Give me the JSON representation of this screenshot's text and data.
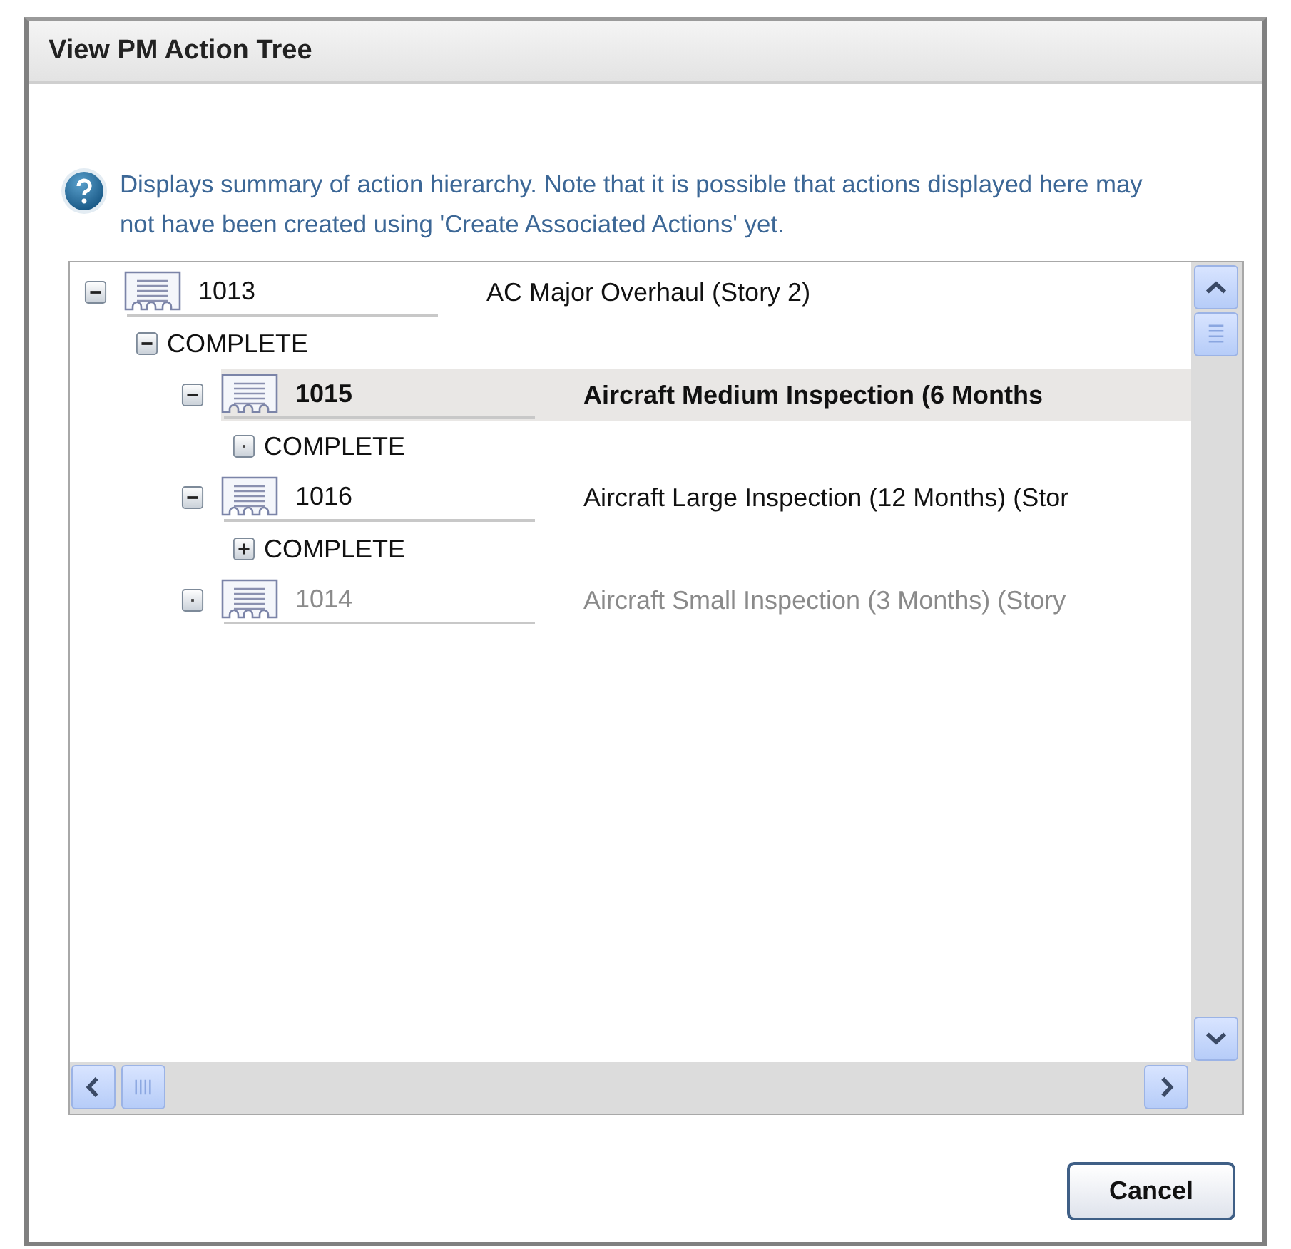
{
  "window": {
    "title": "View PM Action Tree"
  },
  "info": {
    "text": "Displays summary of action hierarchy. Note that it is possible that actions displayed here may not have been created using 'Create Associated Actions' yet."
  },
  "tree": [
    {
      "kind": "action",
      "id": "1013",
      "description": "AC Major Overhaul (Story 2)",
      "expandable": true,
      "expanded": true,
      "selected": false,
      "disabled": false,
      "children": [
        {
          "kind": "status",
          "label": "COMPLETE",
          "expandable": true,
          "expanded": true,
          "children": [
            {
              "kind": "action",
              "id": "1015",
              "description": "Aircraft Medium Inspection (6 Months",
              "expandable": true,
              "expanded": true,
              "selected": true,
              "disabled": false,
              "children": [
                {
                  "kind": "status",
                  "label": "COMPLETE",
                  "expandable": false
                }
              ]
            },
            {
              "kind": "action",
              "id": "1016",
              "description": "Aircraft Large Inspection (12 Months) (Stor",
              "expandable": true,
              "expanded": true,
              "selected": false,
              "disabled": false,
              "children": [
                {
                  "kind": "status",
                  "label": "COMPLETE",
                  "expandable": true,
                  "expanded": false
                }
              ]
            },
            {
              "kind": "action",
              "id": "1014",
              "description": "Aircraft Small Inspection (3 Months) (Story",
              "expandable": false,
              "selected": false,
              "disabled": true
            }
          ]
        }
      ]
    }
  ],
  "buttons": [
    {
      "label": "Cancel"
    }
  ]
}
